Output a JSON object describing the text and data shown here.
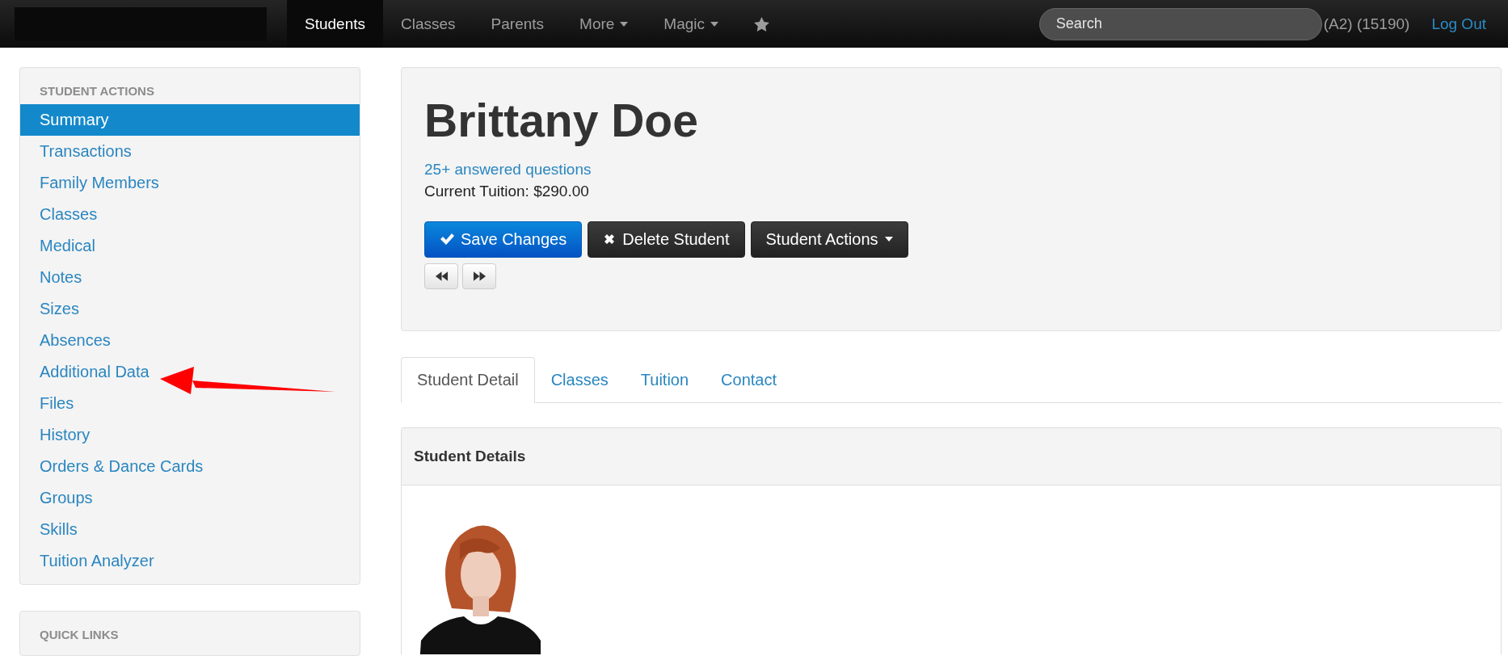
{
  "navbar": {
    "items": [
      {
        "kind": "link",
        "label": "Students",
        "selected": true
      },
      {
        "kind": "link",
        "label": "Classes",
        "selected": false
      },
      {
        "kind": "link",
        "label": "Parents",
        "selected": false
      },
      {
        "kind": "dropdown",
        "label": "More",
        "selected": false
      },
      {
        "kind": "dropdown",
        "label": "Magic",
        "selected": false
      },
      {
        "kind": "star",
        "selected": false
      }
    ],
    "search": {
      "placeholder": "Search"
    },
    "account": "(A2) (15190)",
    "logout": "Log Out"
  },
  "sidebar": {
    "panels": [
      {
        "heading": "STUDENT ACTIONS",
        "items": [
          {
            "label": "Summary",
            "selected": true
          },
          {
            "label": "Transactions",
            "selected": false
          },
          {
            "label": "Family Members",
            "selected": false
          },
          {
            "label": "Classes",
            "selected": false
          },
          {
            "label": "Medical",
            "selected": false
          },
          {
            "label": "Notes",
            "selected": false
          },
          {
            "label": "Sizes",
            "selected": false
          },
          {
            "label": "Absences",
            "selected": false
          },
          {
            "label": "Additional Data",
            "selected": false
          },
          {
            "label": "Files",
            "selected": false
          },
          {
            "label": "History",
            "selected": false
          },
          {
            "label": "Orders & Dance Cards",
            "selected": false
          },
          {
            "label": "Groups",
            "selected": false
          },
          {
            "label": "Skills",
            "selected": false
          },
          {
            "label": "Tuition Analyzer",
            "selected": false
          }
        ]
      },
      {
        "heading": "QUICK LINKS"
      }
    ]
  },
  "student": {
    "name": "Brittany Doe",
    "answered_link": "25+ answered questions",
    "tuition": "Current Tuition: $290.00",
    "buttons": [
      {
        "kind": "primary",
        "label": "Save Changes"
      },
      {
        "kind": "danger",
        "label": "Delete Student"
      },
      {
        "kind": "dropdown",
        "label": "Student Actions"
      }
    ],
    "pager": [
      {
        "kind": "previous"
      },
      {
        "kind": "next"
      }
    ]
  },
  "tabs": [
    {
      "label": "Student Detail",
      "selected": true
    },
    {
      "label": "Classes",
      "selected": false
    },
    {
      "label": "Tuition",
      "selected": false
    },
    {
      "label": "Contact",
      "selected": false
    }
  ],
  "details": {
    "title": "Student Details"
  }
}
